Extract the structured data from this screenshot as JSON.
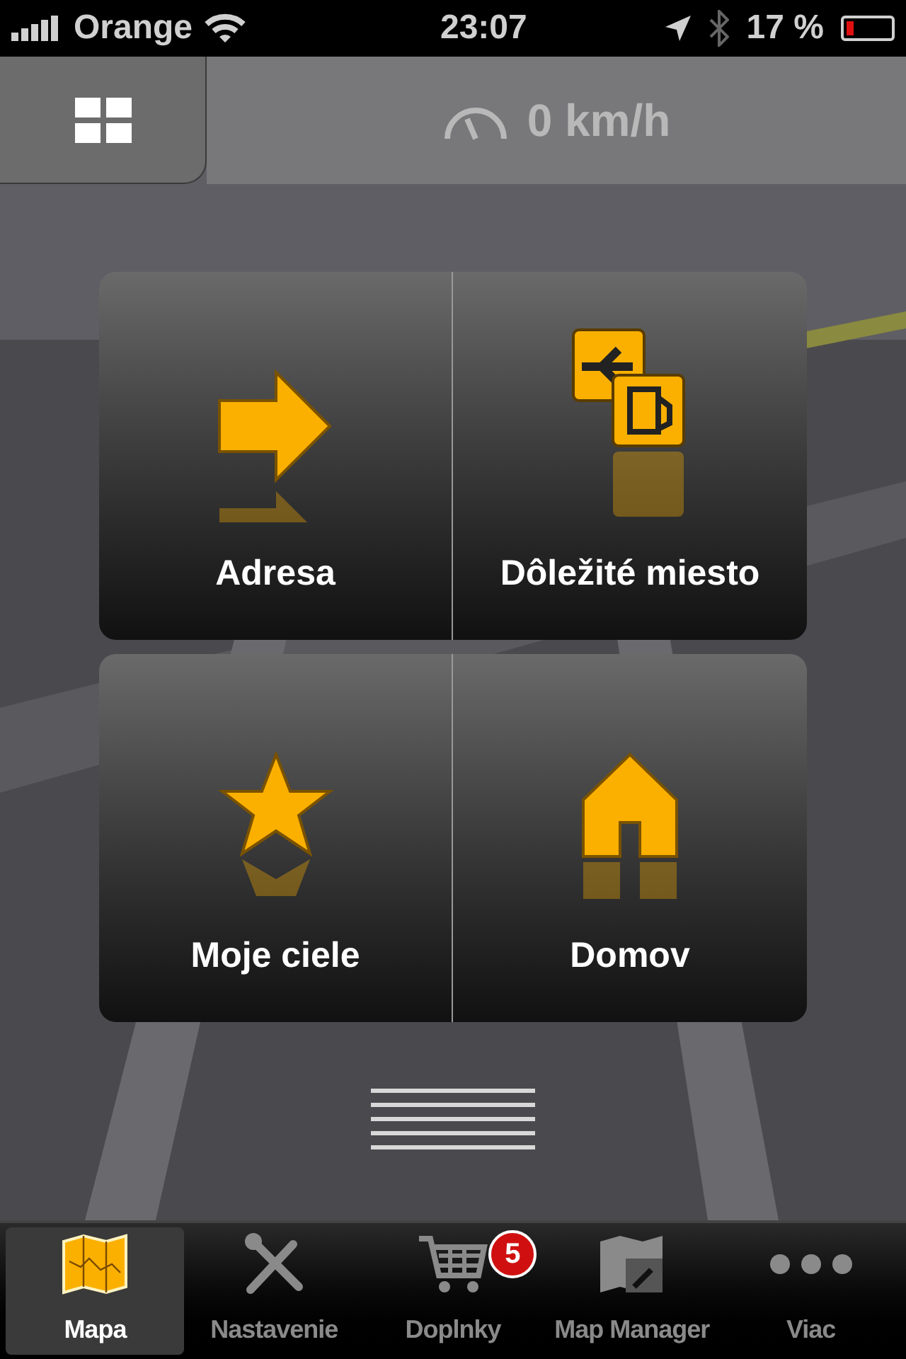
{
  "status_bar": {
    "carrier": "Orange",
    "time": "23:07",
    "battery": "17 %"
  },
  "header": {
    "speed": "0 km/h"
  },
  "menu": [
    {
      "label": "Adresa",
      "kind": "address"
    },
    {
      "label": "Dôležité miesto",
      "kind": "poi"
    },
    {
      "label": "Moje ciele",
      "kind": "favorites"
    },
    {
      "label": "Domov",
      "kind": "home"
    }
  ],
  "tabs": [
    {
      "label": "Mapa",
      "kind": "map",
      "selected": true
    },
    {
      "label": "Nastavenie",
      "kind": "settings",
      "selected": false
    },
    {
      "label": "Doplnky",
      "kind": "cart",
      "selected": false,
      "badge": "5"
    },
    {
      "label": "Map Manager",
      "kind": "manager",
      "selected": false
    },
    {
      "label": "Viac",
      "kind": "more",
      "selected": false
    }
  ]
}
